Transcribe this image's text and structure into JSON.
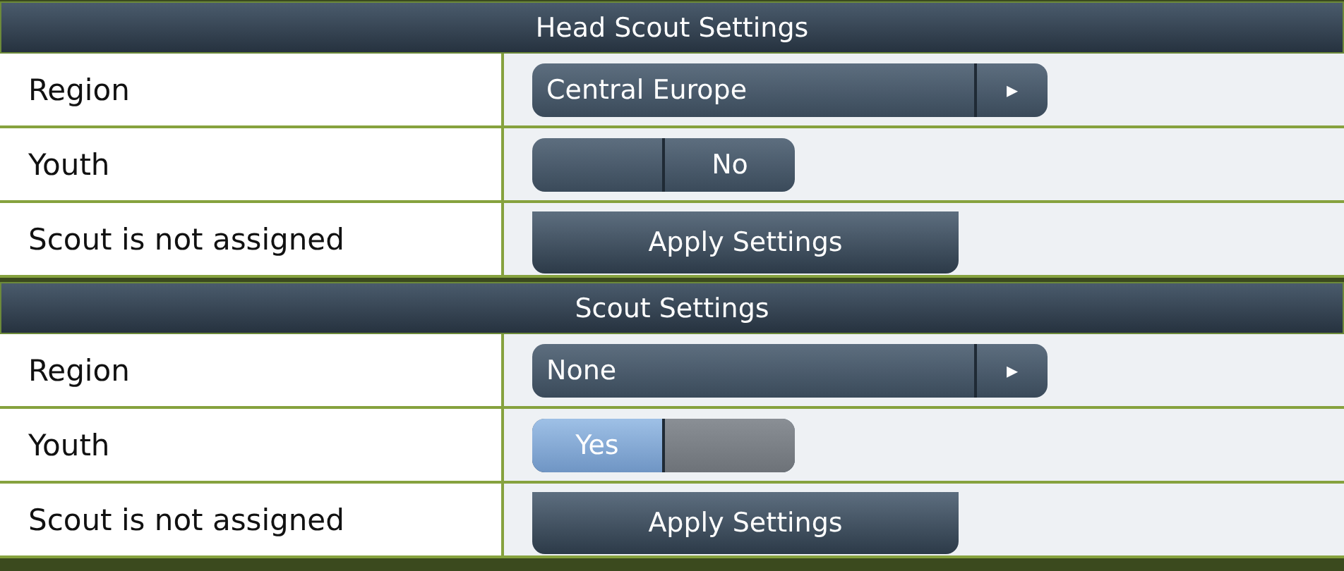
{
  "sections": [
    {
      "title": "Head Scout Settings",
      "region": {
        "label": "Region",
        "value": "Central Europe",
        "arrow": "▸"
      },
      "youth": {
        "label": "Youth",
        "value": "No",
        "on": false
      },
      "status": {
        "label": "Scout is not assigned",
        "button": "Apply Settings"
      }
    },
    {
      "title": "Scout Settings",
      "region": {
        "label": "Region",
        "value": "None",
        "arrow": "▸"
      },
      "youth": {
        "label": "Youth",
        "value": "Yes",
        "on": true
      },
      "status": {
        "label": "Scout is not assigned",
        "button": "Apply Settings"
      }
    }
  ]
}
